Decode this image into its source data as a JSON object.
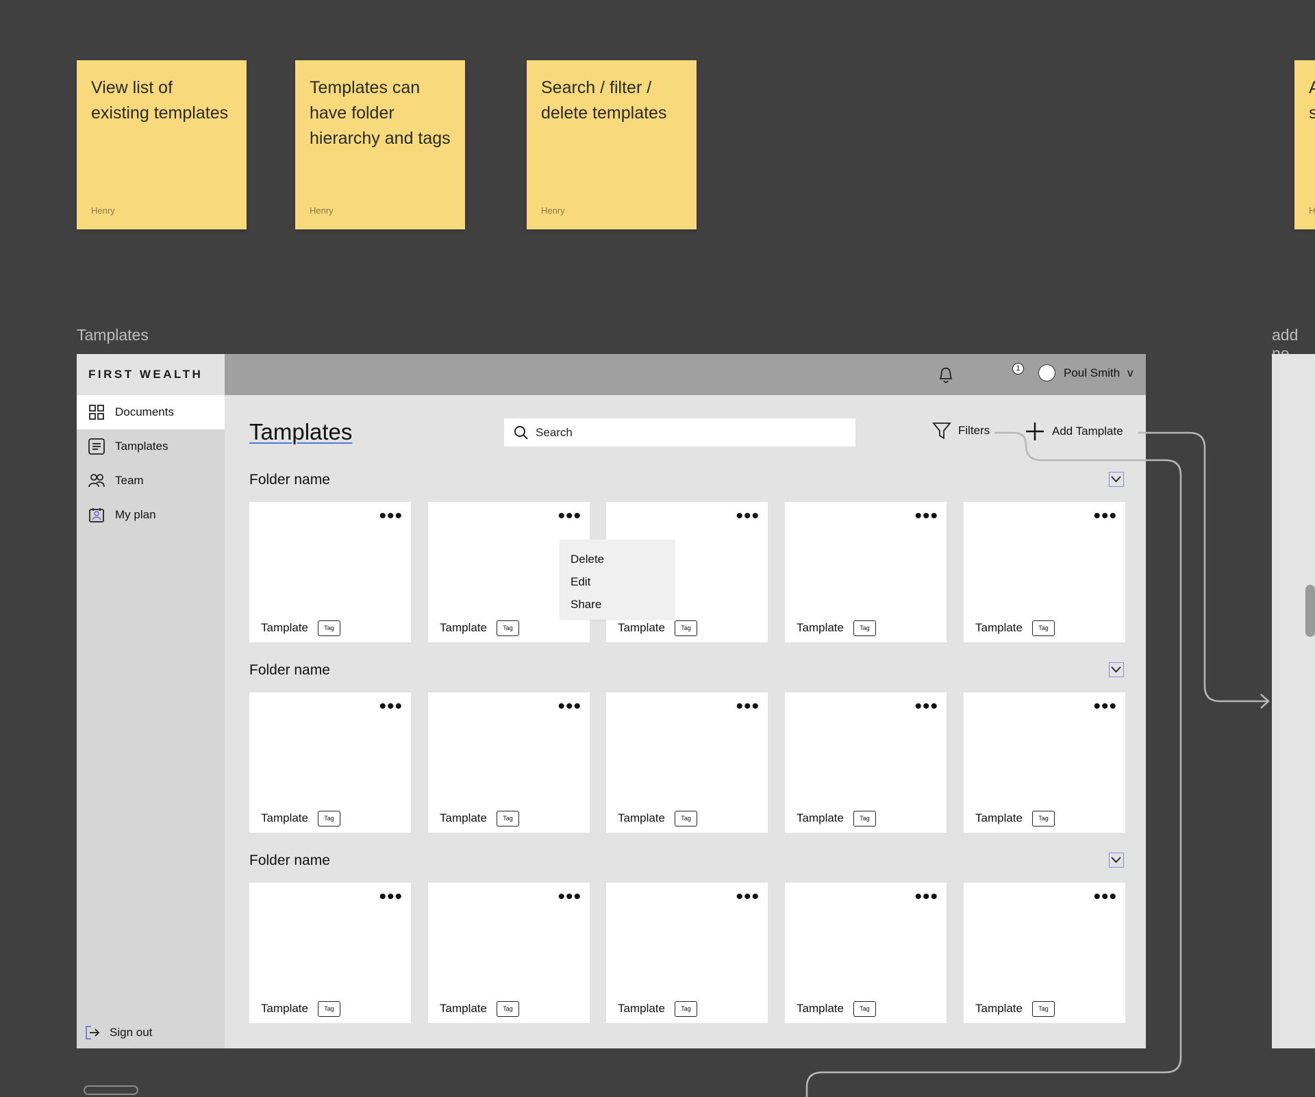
{
  "stickies": [
    {
      "text": "View list of existing templates",
      "author": "Henry"
    },
    {
      "text": "Templates can have folder hierarchy and tags",
      "author": "Henry"
    },
    {
      "text": "Search / filter / delete templates",
      "author": "Henry"
    },
    {
      "text": "A s",
      "author": "H"
    }
  ],
  "frame_labels": {
    "main": "Tamplates",
    "right": "add ne"
  },
  "app": {
    "logo": "FIRST WEALTH",
    "nav": [
      {
        "label": "Documents",
        "icon": "grid-icon"
      },
      {
        "label": "Tamplates",
        "icon": "document-icon"
      },
      {
        "label": "Team",
        "icon": "team-icon"
      },
      {
        "label": "My plan",
        "icon": "plan-icon"
      }
    ],
    "signout": "Sign out",
    "notification_count": "1",
    "user_name": "Poul Smith",
    "user_caret": "v",
    "page_title": "Tamplates",
    "search_placeholder": "Search",
    "filters_label": "Filters",
    "add_label": "Add Tamplate",
    "folders": [
      {
        "name": "Folder name",
        "cards": [
          {
            "label": "Tamplate",
            "tag": "Tag"
          },
          {
            "label": "Tamplate",
            "tag": "Tag"
          },
          {
            "label": "Tamplate",
            "tag": "Tag"
          },
          {
            "label": "Tamplate",
            "tag": "Tag"
          },
          {
            "label": "Tamplate",
            "tag": "Tag"
          }
        ]
      },
      {
        "name": "Folder name",
        "cards": [
          {
            "label": "Tamplate",
            "tag": "Tag"
          },
          {
            "label": "Tamplate",
            "tag": "Tag"
          },
          {
            "label": "Tamplate",
            "tag": "Tag"
          },
          {
            "label": "Tamplate",
            "tag": "Tag"
          },
          {
            "label": "Tamplate",
            "tag": "Tag"
          }
        ]
      },
      {
        "name": "Folder name",
        "cards": [
          {
            "label": "Tamplate",
            "tag": "Tag"
          },
          {
            "label": "Tamplate",
            "tag": "Tag"
          },
          {
            "label": "Tamplate",
            "tag": "Tag"
          },
          {
            "label": "Tamplate",
            "tag": "Tag"
          },
          {
            "label": "Tamplate",
            "tag": "Tag"
          }
        ]
      }
    ],
    "context_menu": [
      "Delete",
      "Edit",
      "Share"
    ],
    "card_menu_glyph": "•••"
  },
  "colors": {
    "canvas": "#404040",
    "sticky": "#f8d97c",
    "frame_bg": "#e3e3e3",
    "sidebar": "#d6d6d6",
    "topbar": "#a0a0a0",
    "accent_underline": "#4a7bd8",
    "chevron_border": "#8a88d8"
  }
}
